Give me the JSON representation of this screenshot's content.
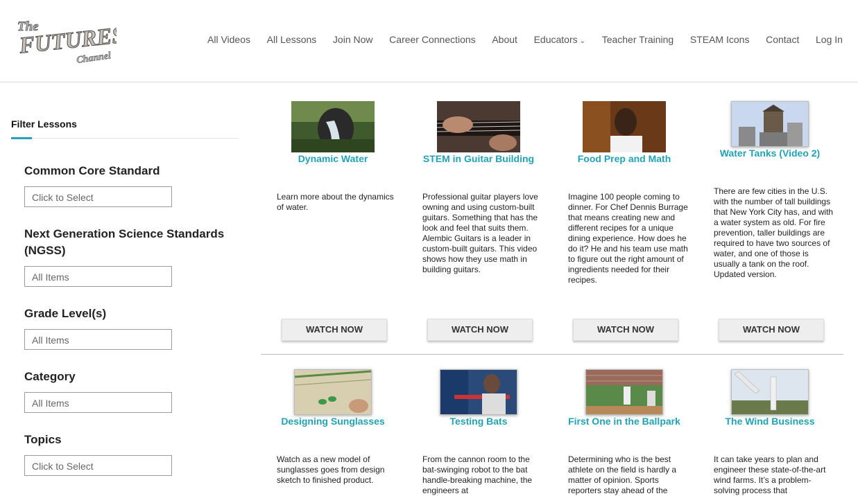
{
  "logo": {
    "line1": "The",
    "line2": "FUTURES",
    "line3": "Channel"
  },
  "nav": {
    "items": [
      "All Videos",
      "All Lessons",
      "Join Now",
      "Career Connections",
      "About",
      "Educators",
      "Teacher Training",
      "STEAM Icons",
      "Contact",
      "Log In"
    ]
  },
  "sidebar": {
    "title": "Filter Lessons",
    "filters": [
      {
        "label": "Common Core Standard",
        "value": "Click to Select"
      },
      {
        "label": "Next Generation Science Standards (NGSS)",
        "value": "All Items"
      },
      {
        "label": "Grade Level(s)",
        "value": "All Items"
      },
      {
        "label": "Category",
        "value": "All Items"
      },
      {
        "label": "Topics",
        "value": "Click to Select"
      }
    ]
  },
  "watch_label": "WATCH NOW",
  "cards": [
    {
      "title": "Dynamic Water",
      "desc": "Learn more about the dynamics of water."
    },
    {
      "title": "STEM in Guitar Building",
      "desc": "Professional guitar players love owning and using custom-built guitars. Something that has the look and feel that suits them. Alembic Guitars is a leader in custom-built guitars. This video shows how they use math in building guitars."
    },
    {
      "title": "Food Prep and Math",
      "desc": "Imagine 100 people coming to dinner. For Chef Dennis Burrage that means creating new and different recipes for a unique dining experience. How does he do it? He and his team use math to figure out the right amount of ingredients needed for their recipes."
    },
    {
      "title": "Water Tanks (Video 2)",
      "desc": "There are few cities in the U.S. with the number of tall buildings that New York City has, and with a water system as old. For fire prevention, taller buildings are required to have two sources of water, and one of those is usually a tank on the roof. Updated version."
    },
    {
      "title": "Designing Sunglasses",
      "desc": "Watch as a new model of sunglasses goes from design sketch to finished product."
    },
    {
      "title": "Testing Bats",
      "desc": "From the cannon room to the bat-swinging robot to the bat handle-breaking machine, the engineers at"
    },
    {
      "title": "First One in the Ballpark",
      "desc": "Determining who is the best athlete on the field is hardly a matter of opinion. Sports reporters stay ahead of the"
    },
    {
      "title": "The Wind Business",
      "desc": "It can take years to plan and engineer these state-of-the-art wind farms. It’s a problem-solving process that"
    }
  ]
}
